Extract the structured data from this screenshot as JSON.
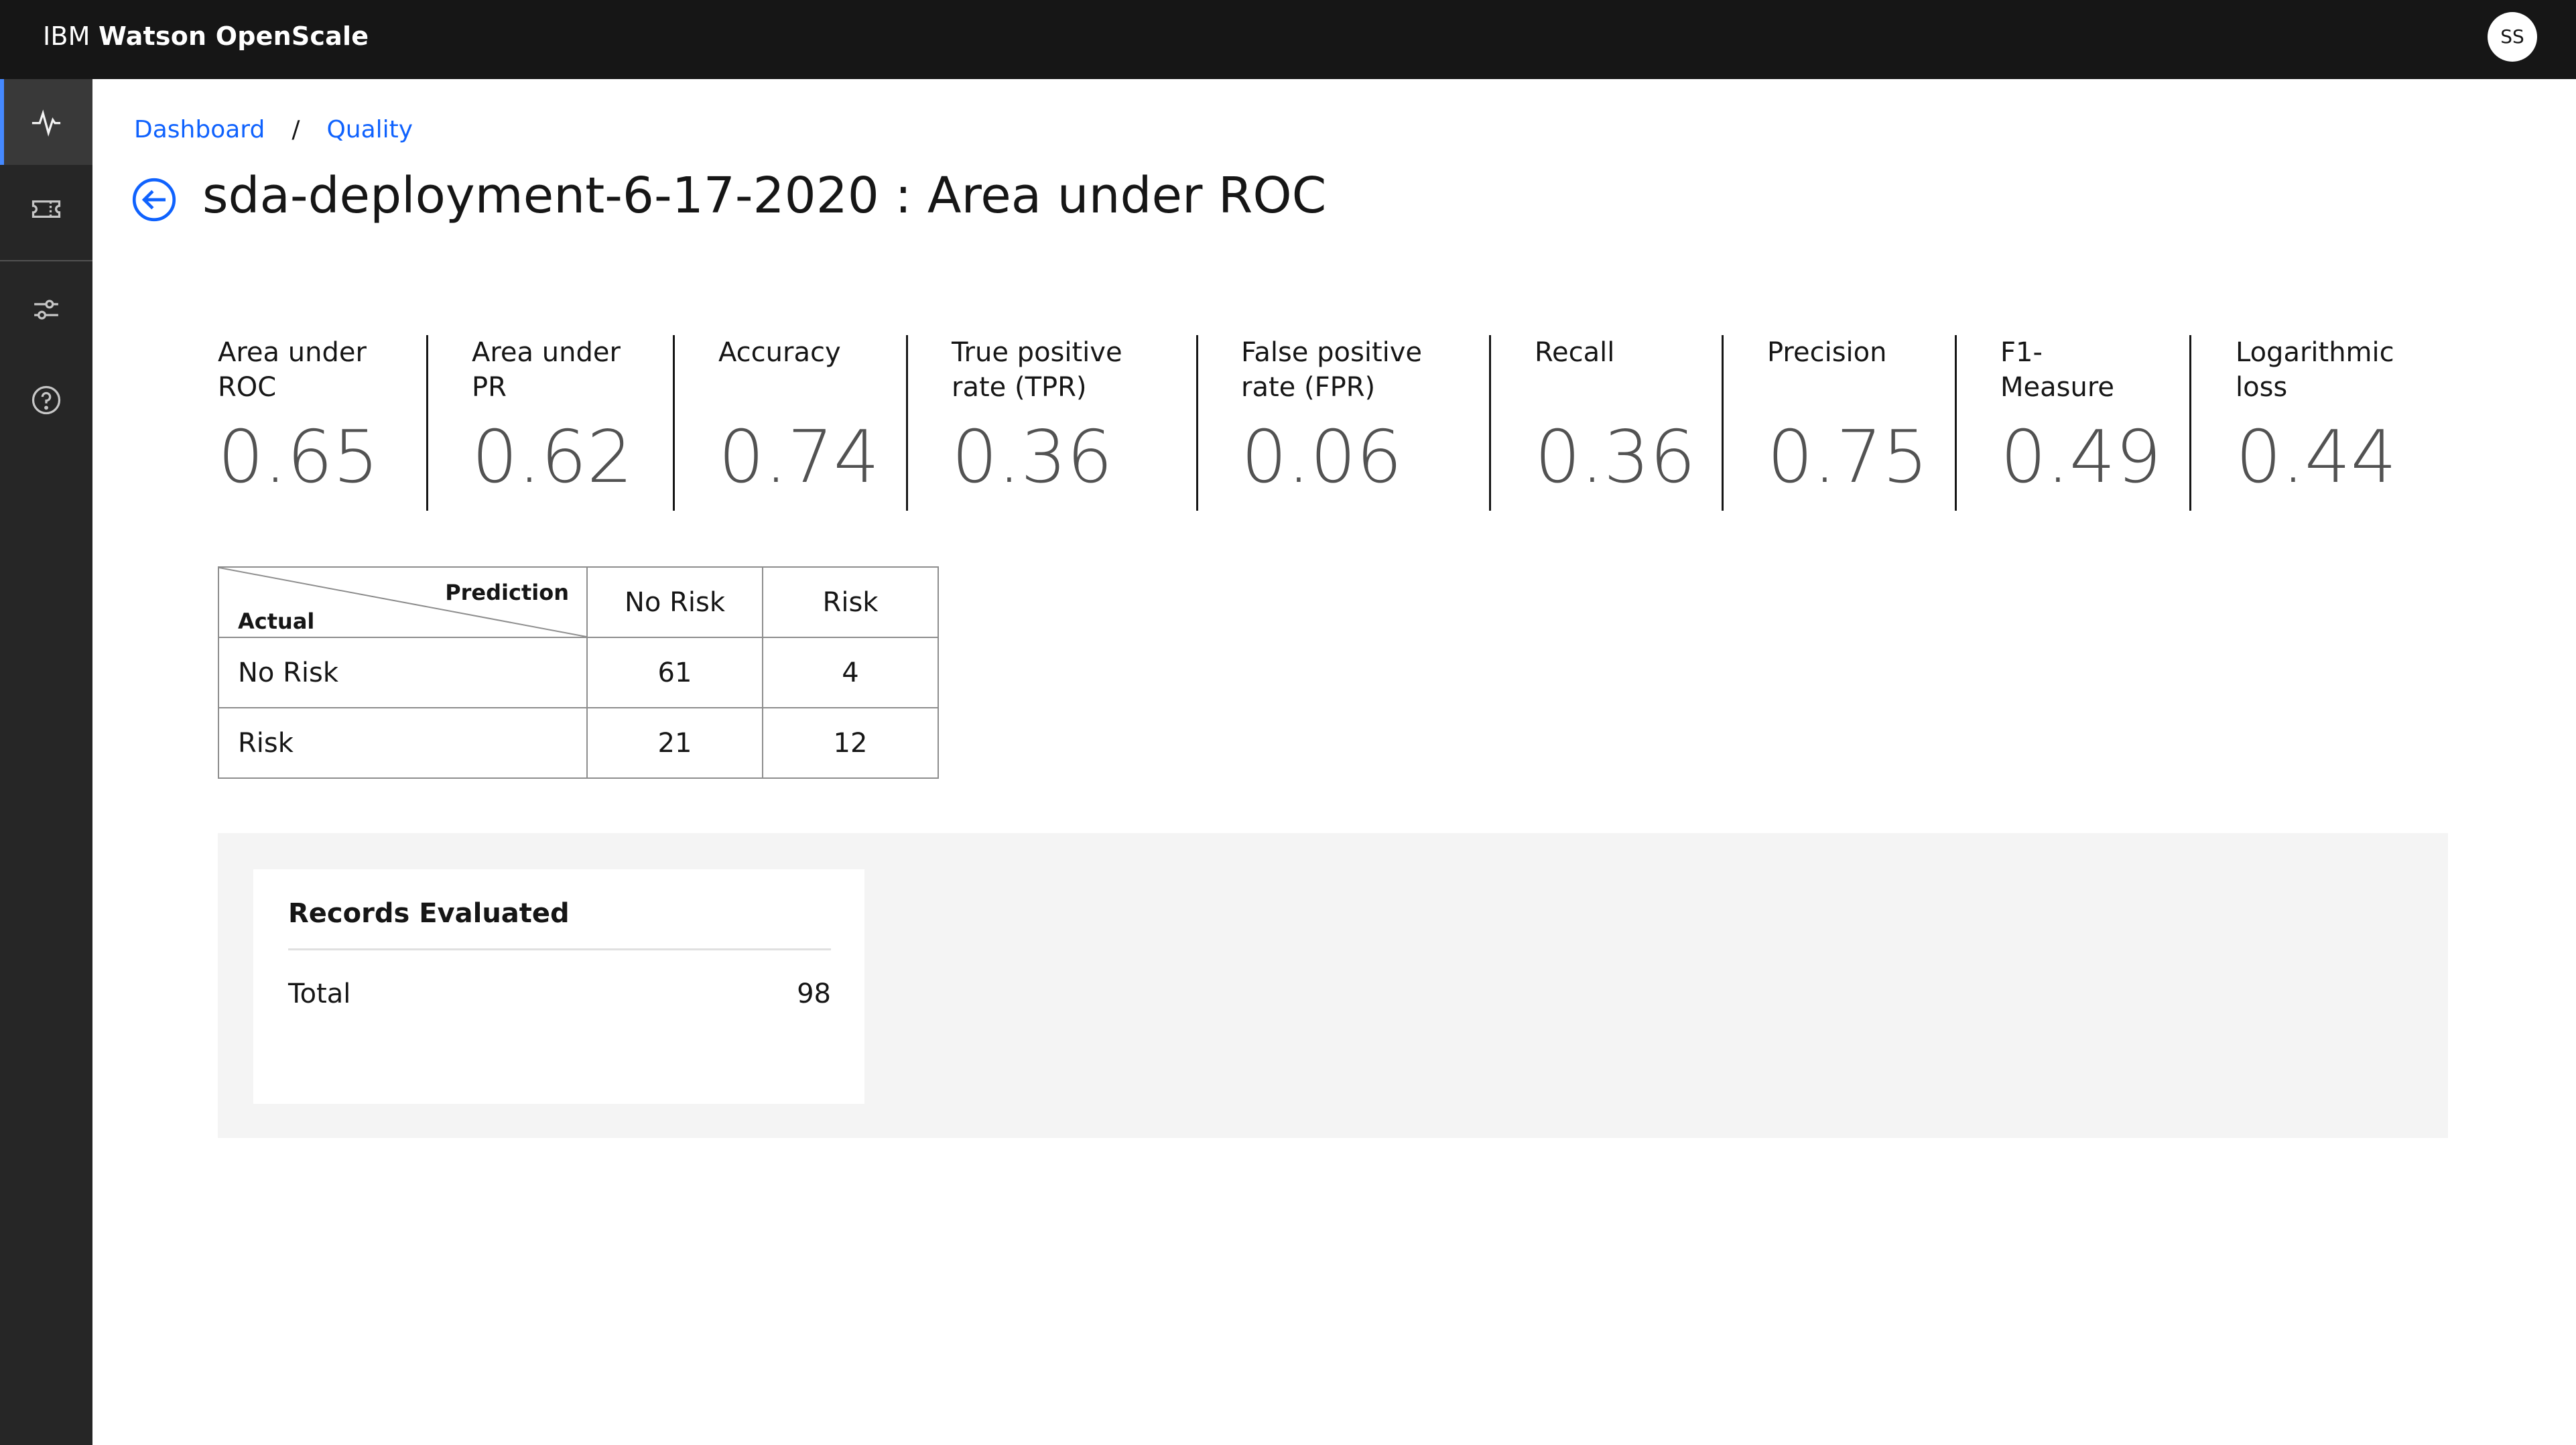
{
  "header": {
    "brand_ibm": "IBM",
    "brand_product": "Watson OpenScale",
    "avatar_initials": "SS"
  },
  "rail": {
    "items": [
      {
        "icon": "activity-icon",
        "active": true
      },
      {
        "icon": "ticket-icon",
        "active": false
      },
      {
        "icon": "sliders-icon",
        "active": false
      },
      {
        "icon": "help-icon",
        "active": false
      }
    ]
  },
  "breadcrumb": {
    "items": [
      "Dashboard",
      "Quality"
    ],
    "separator": "/"
  },
  "page": {
    "title": "sda-deployment-6-17-2020 : Area under ROC"
  },
  "metrics": [
    {
      "label_line1": "Area under",
      "label_line2": "ROC",
      "value": "0.65"
    },
    {
      "label_line1": "Area under",
      "label_line2": "PR",
      "value": "0.62"
    },
    {
      "label_line1": "Accuracy",
      "label_line2": "",
      "value": "0.74"
    },
    {
      "label_line1": "True positive",
      "label_line2": "rate (TPR)",
      "value": "0.36"
    },
    {
      "label_line1": "False positive",
      "label_line2": "rate (FPR)",
      "value": "0.06"
    },
    {
      "label_line1": "Recall",
      "label_line2": "",
      "value": "0.36"
    },
    {
      "label_line1": "Precision",
      "label_line2": "",
      "value": "0.75"
    },
    {
      "label_line1": "F1-",
      "label_line2": "Measure",
      "value": "0.49"
    },
    {
      "label_line1": "Logarithmic",
      "label_line2": "loss",
      "value": "0.44"
    }
  ],
  "confusion_matrix": {
    "prediction_label": "Prediction",
    "actual_label": "Actual",
    "columns": [
      "No Risk",
      "Risk"
    ],
    "rows": [
      {
        "label": "No Risk",
        "values": [
          "61",
          "4"
        ]
      },
      {
        "label": "Risk",
        "values": [
          "21",
          "12"
        ]
      }
    ]
  },
  "records": {
    "title": "Records Evaluated",
    "total_label": "Total",
    "total_value": "98"
  },
  "colors": {
    "header_bg": "#161616",
    "rail_bg": "#262626",
    "accent": "#0f62fe",
    "active_indicator": "#4589ff",
    "panel_bg": "#f4f4f4"
  }
}
